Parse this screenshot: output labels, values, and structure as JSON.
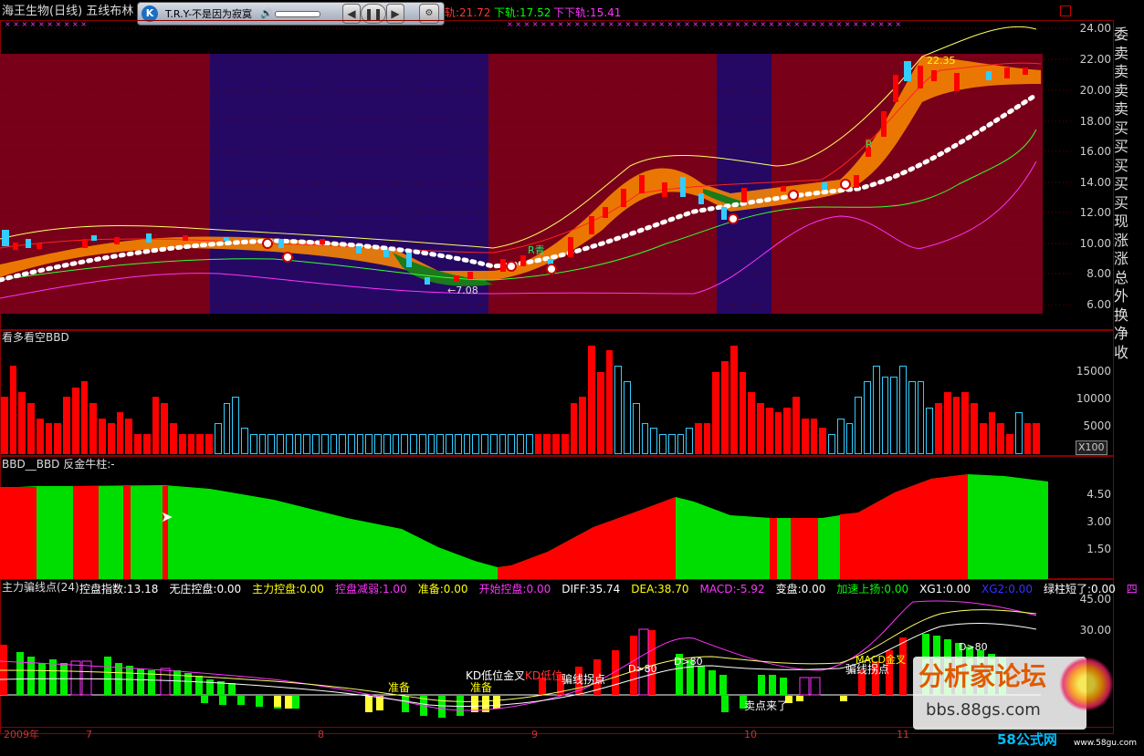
{
  "header": {
    "title": "海王生物(日线) 五线布林",
    "upper_label": "轨:21.72",
    "lower_label": "下轨:17.52",
    "lowest_label": "下下轨:15.41"
  },
  "player": {
    "logo": "K",
    "song": "T.R.Y-不是因为寂寞",
    "prev": "◀",
    "pause": "❚❚",
    "next": "▶"
  },
  "price_axis": [
    "24.00",
    "22.00",
    "20.00",
    "18.00",
    "16.00",
    "14.00",
    "12.00",
    "10.00",
    "8.00",
    "6.00"
  ],
  "price_annotations": {
    "low": "←7.08",
    "high": "22.35",
    "r_green": "R",
    "r_cyan": "R青"
  },
  "right_col": [
    "委",
    "卖",
    "卖",
    "卖",
    "卖",
    "买",
    "买",
    "买",
    "买",
    "买",
    "现",
    "涨",
    "涨",
    "总",
    "外",
    "换",
    "净",
    "收"
  ],
  "bbd_panel": {
    "title": "看多看空BBD",
    "axis": [
      "15000",
      "10000",
      "5000"
    ],
    "unit": "X100",
    "values": [
      37,
      57,
      40,
      33,
      23,
      20,
      20,
      37,
      43,
      47,
      33,
      23,
      20,
      27,
      23,
      13,
      13,
      37,
      33,
      20,
      13,
      13,
      13,
      13,
      20,
      33,
      37,
      17,
      13,
      13,
      13,
      13,
      13,
      13,
      13,
      13,
      13,
      13,
      13,
      13,
      13,
      13,
      13,
      13,
      13,
      13,
      13,
      13,
      13,
      13,
      13,
      13,
      13,
      13,
      13,
      13,
      13,
      13,
      13,
      13,
      13,
      13,
      13,
      13,
      33,
      37,
      70,
      53,
      67,
      57,
      47,
      33,
      20,
      17,
      13,
      13,
      13,
      17,
      20,
      20,
      53,
      60,
      70,
      53,
      40,
      33,
      30,
      27,
      30,
      37,
      23,
      23,
      17,
      13,
      23,
      20,
      37,
      47,
      57,
      50,
      50,
      57,
      47,
      47,
      30,
      33,
      40,
      37,
      40,
      33,
      20,
      27,
      20,
      13,
      27,
      20,
      20,
      20,
      23,
      27,
      43,
      47,
      30,
      27,
      27
    ],
    "colors": "rrrrrrrrrrrrrrrrrrrrrrrrccccccccccccccccccccccccccccccccccccrrrrrrrrrcccccccccrrrrrrrrrrrrrrrccccccccccccrrrrrrrrrcrrrrrrrrrrrrrrrrrrrrrrrrrrrrrrrrrrrrrrrrr"
  },
  "golden_panel": {
    "title": "BBD__BBD 反金牛柱:-",
    "axis": [
      "4.50",
      "3.00",
      "1.50"
    ]
  },
  "macd_panel": {
    "title": "主力骗线点(24)",
    "fields": [
      {
        "label": "控盘指数:13.18",
        "color": "#ffffff"
      },
      {
        "label": "无庄控盘:0.00",
        "color": "#ffffff"
      },
      {
        "label": "主力控盘:0.00",
        "color": "#ffff00"
      },
      {
        "label": "控盘减弱:1.00",
        "color": "#ff33ff"
      },
      {
        "label": "准备:0.00",
        "color": "#ffff00"
      },
      {
        "label": "开始控盘:0.00",
        "color": "#ff33ff"
      },
      {
        "label": "DIFF:35.74",
        "color": "#ffffff"
      },
      {
        "label": "DEA:38.70",
        "color": "#ffff00"
      },
      {
        "label": "MACD:-5.92",
        "color": "#ff33ff"
      },
      {
        "label": "变盘:0.00",
        "color": "#ffffff"
      },
      {
        "label": "加速上扬:0.00",
        "color": "#00ff00"
      },
      {
        "label": "XG1:0.00",
        "color": "#ffffff"
      },
      {
        "label": "XG2:0.00",
        "color": "#3333ff"
      },
      {
        "label": "绿柱短了:0.00",
        "color": "#ffffff"
      },
      {
        "label": "四",
        "color": "#ff33ff"
      }
    ],
    "axis": [
      "45.00",
      "30.00"
    ],
    "annotations": {
      "prepare1": "准备",
      "prepare2": "准备",
      "kd": "KD低位金叉",
      "kd2": "KD低位",
      "fake_turn": "骗线拐点",
      "d80a": "D>80",
      "d80b": "D>80",
      "d80c": "D>80",
      "sell": "卖点来了",
      "macd_gold": "MACD金叉",
      "fake_turn2": "骗线拐点"
    },
    "date_axis": [
      "2009年",
      "7",
      "8",
      "9",
      "10",
      "11"
    ]
  },
  "watermark": {
    "title": "分析家论坛",
    "url": "bbs.88gs.com",
    "brand": "58公式网",
    "brand_url": "www.58gu.com"
  },
  "colors": {
    "bg_red": "#780018",
    "bg_blue": "#240864",
    "bull": "#ff0000",
    "bear": "#00ff00",
    "cyan": "#33ccff"
  }
}
